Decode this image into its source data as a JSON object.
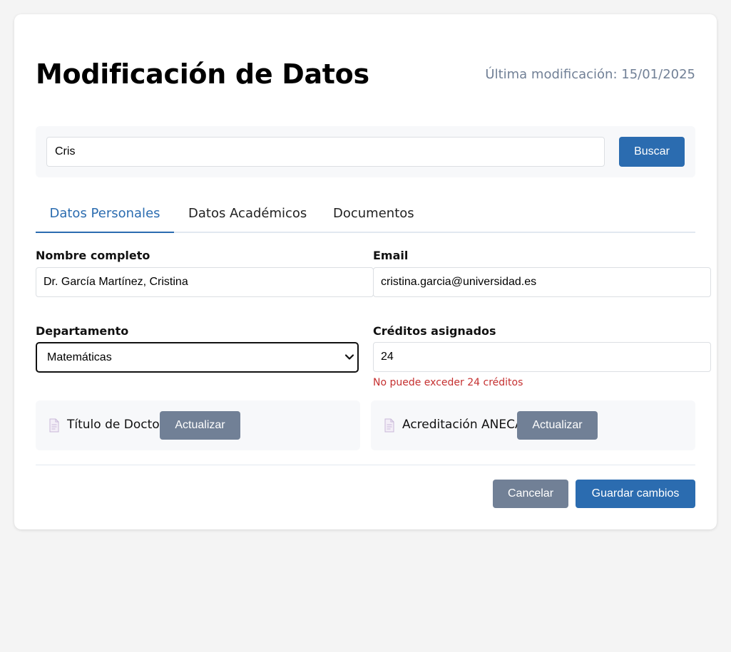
{
  "header": {
    "title": "Modificación de Datos",
    "last_modified": "Última modificación: 15/01/2025"
  },
  "search": {
    "value": "Cris",
    "button_label": "Buscar"
  },
  "tabs": [
    {
      "label": "Datos Personales",
      "active": true
    },
    {
      "label": "Datos Académicos",
      "active": false
    },
    {
      "label": "Documentos",
      "active": false
    }
  ],
  "form": {
    "full_name": {
      "label": "Nombre completo",
      "value": "Dr. García Martínez, Cristina"
    },
    "email": {
      "label": "Email",
      "value": "cristina.garcia@universidad.es"
    },
    "department": {
      "label": "Departamento",
      "value": "Matemáticas"
    },
    "credits": {
      "label": "Créditos asignados",
      "value": "24",
      "error": "No puede exceder 24 créditos"
    }
  },
  "documents": [
    {
      "label": "Título de Doctor",
      "button_label": "Actualizar",
      "icon": "document-icon"
    },
    {
      "label": "Acreditación ANECA",
      "button_label": "Actualizar",
      "icon": "document-icon"
    }
  ],
  "actions": {
    "cancel_label": "Cancelar",
    "save_label": "Guardar cambios"
  },
  "colors": {
    "primary": "#2b6cb0",
    "secondary": "#718096",
    "error": "#c53030",
    "background": "#f4f4f4"
  }
}
